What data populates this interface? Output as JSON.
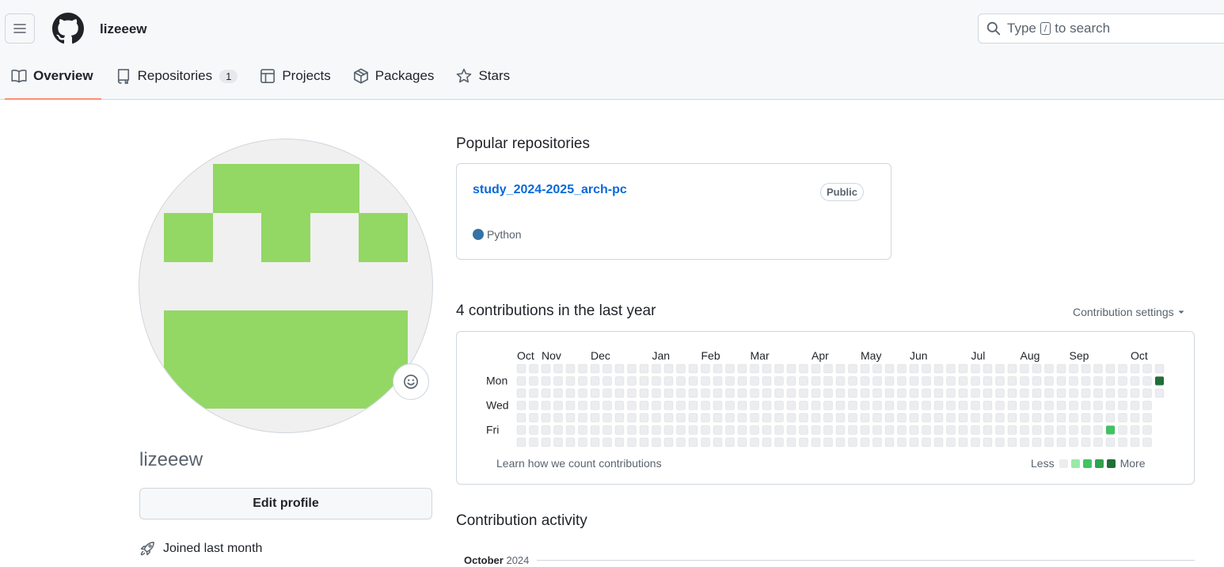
{
  "header": {
    "username": "lizeeew",
    "search_prefix": "Type",
    "search_key": "/",
    "search_suffix": "to search"
  },
  "tabs": [
    {
      "label": "Overview",
      "icon": "book-icon",
      "active": true
    },
    {
      "label": "Repositories",
      "icon": "repo-icon",
      "count": "1"
    },
    {
      "label": "Projects",
      "icon": "table-icon"
    },
    {
      "label": "Packages",
      "icon": "package-icon"
    },
    {
      "label": "Stars",
      "icon": "star-icon"
    }
  ],
  "profile": {
    "name": "lizeeew",
    "edit_label": "Edit profile",
    "joined": "Joined last month",
    "avatar_color": "#93d765",
    "avatar_bg": "#f0f0f0"
  },
  "popular": {
    "title": "Popular repositories",
    "repos": [
      {
        "name": "study_2024-2025_arch-pc",
        "visibility": "Public",
        "language": "Python",
        "language_color": "#3572A5"
      }
    ]
  },
  "contributions": {
    "title": "4 contributions in the last year",
    "settings_label": "Contribution settings",
    "months": [
      "Oct",
      "Nov",
      "Dec",
      "Jan",
      "Feb",
      "Mar",
      "Apr",
      "May",
      "Jun",
      "Jul",
      "Aug",
      "Sep",
      "Oct"
    ],
    "day_labels": [
      "Mon",
      "Wed",
      "Fri"
    ],
    "learn_label": "Learn how we count contributions",
    "legend_less": "Less",
    "legend_more": "More",
    "level_colors": [
      "#ebedf0",
      "#9be9a8",
      "#40c463",
      "#30a14e",
      "#216e39"
    ],
    "active_cells": [
      {
        "week": 52,
        "day": 1,
        "level": 4
      },
      {
        "week": 48,
        "day": 5,
        "level": 2
      }
    ]
  },
  "activity": {
    "title": "Contribution activity",
    "month": "October",
    "year": "2024"
  }
}
